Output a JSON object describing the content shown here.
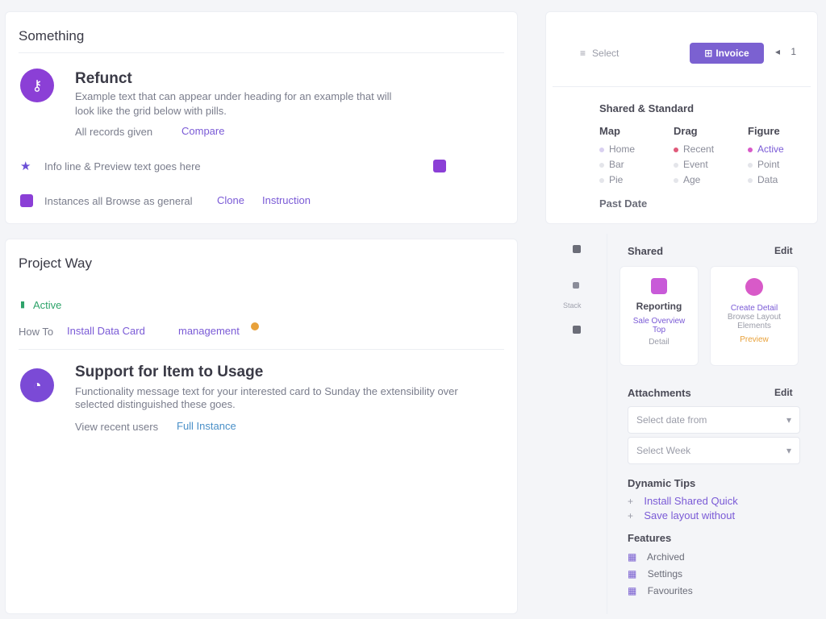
{
  "colors": {
    "accent": "#7b61d1",
    "purple": "#8b3fd6",
    "green": "#2ea36a",
    "orange": "#e8a13a",
    "pink": "#d85ac8"
  },
  "top_card": {
    "title": "Something",
    "item": {
      "icon": "key-icon",
      "heading": "Refunct",
      "desc1": "Example text that can appear under heading for an example that will",
      "desc2": "look like the grid below with pills.",
      "meta": "All records given",
      "meta_link": "Compare"
    },
    "row1": {
      "text": "Info line & Preview text goes here",
      "icon": "star-icon"
    },
    "row2": {
      "text": "Instances all Browse as general",
      "link1": "Clone",
      "link2": "Instruction"
    }
  },
  "bottom_card": {
    "title": "Project Way",
    "status": "Active",
    "links_prefix": "How To",
    "link1": "Install Data Card",
    "link2": "management",
    "item": {
      "heading": "Support for Item to Usage",
      "desc1": "Functionality message text for your interested card to Sunday the extensibility over",
      "desc2": "selected distinguished these goes.",
      "meta": "View recent users",
      "meta_link": "Full Instance"
    }
  },
  "right_top": {
    "search_placeholder": "Select",
    "button_label": "Invoice",
    "pager": "1",
    "heading": "Shared & Standard",
    "columns": [
      {
        "head": "Map",
        "items": [
          "Home",
          "Bar",
          "Pie"
        ]
      },
      {
        "head": "Drag",
        "items": [
          "Recent",
          "Event",
          "Age"
        ]
      },
      {
        "head": "Figure",
        "items": [
          "Active",
          "Point",
          "Data"
        ]
      }
    ],
    "footer": "Past Date"
  },
  "rail": {
    "label": "Stack"
  },
  "right_panel": {
    "section1_title": "Shared",
    "section1_action": "Edit",
    "tile1": {
      "title": "Reporting",
      "line1": "Sale Overview",
      "line2": "Top",
      "line3": "Detail"
    },
    "tile2": {
      "line1": "Create Detail",
      "line2": "Browse Layout",
      "line3": "Elements",
      "line4": "Preview"
    },
    "section2_title": "Attachments",
    "section2_action": "Edit",
    "select1": "Select date from",
    "select2": "Select Week",
    "dynamic_title": "Dynamic Tips",
    "dynamic_links": [
      "Install Shared Quick",
      "Save layout without"
    ],
    "features_title": "Features",
    "features": [
      "Archived",
      "Settings",
      "Favourites"
    ]
  }
}
